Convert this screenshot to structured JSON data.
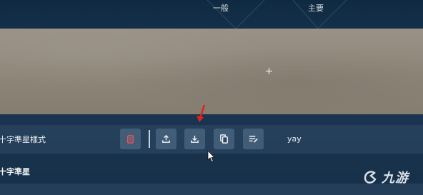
{
  "top_tabs": {
    "general_label": "一般",
    "primary_label": "主要"
  },
  "crosshair_row": {
    "label": "十字準星樣式",
    "preset_name": "yay"
  },
  "toolbar": {
    "buttons": [
      {
        "name": "delete",
        "icon": "trash-icon",
        "color": "#e0575b"
      },
      {
        "name": "export",
        "icon": "upload-icon"
      },
      {
        "name": "import",
        "icon": "download-icon"
      },
      {
        "name": "duplicate",
        "icon": "copy-icon"
      },
      {
        "name": "rename",
        "icon": "edit-list-icon"
      }
    ]
  },
  "section": {
    "title": "十字準星"
  },
  "watermark": {
    "text": "九游"
  },
  "colors": {
    "accent_arrow": "#e0241b",
    "background": "#10263a"
  }
}
